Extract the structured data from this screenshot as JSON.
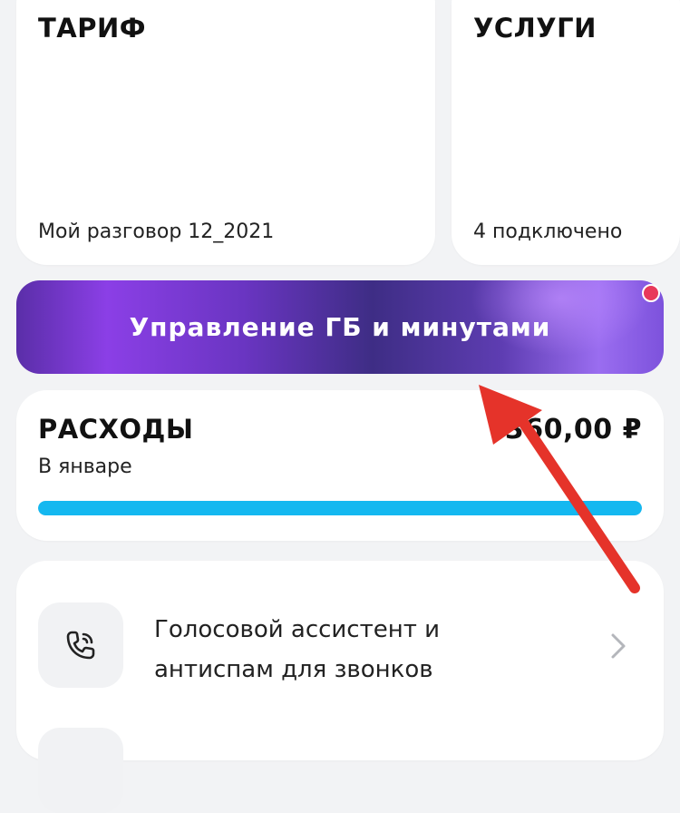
{
  "tariff": {
    "title": "ТАРИФ",
    "plan_name": "Мой разговор 12_2021"
  },
  "services": {
    "title": "УСЛУГИ",
    "connected": "4 подключено"
  },
  "manage_button": {
    "label": "Управление ГБ и минутами",
    "has_notification": true
  },
  "expenses": {
    "title": "РАСХОДЫ",
    "period": "В январе",
    "amount": "360,00 ₽",
    "progress_percent": 100
  },
  "assistant": {
    "title_line1": "Голосовой ассистент и",
    "title_line2": "антиспам для звонков",
    "icon": "phone-voice-icon"
  },
  "colors": {
    "accent_purple": "#7a3fe0",
    "progress": "#14b8f0",
    "annotation_arrow": "#e5332a",
    "notification_dot": "#e8385a"
  }
}
